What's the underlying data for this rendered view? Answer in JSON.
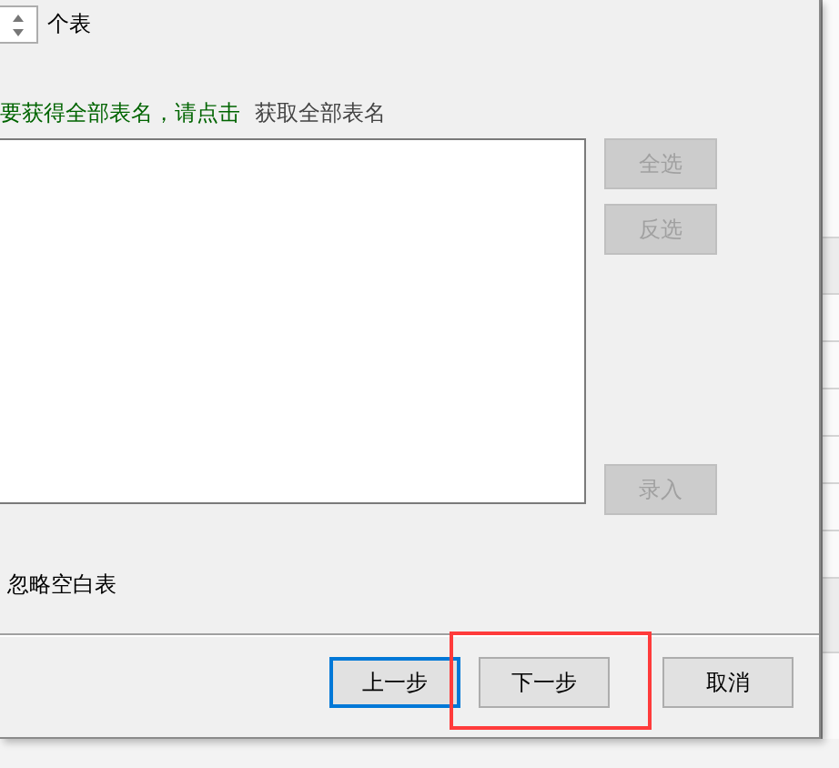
{
  "count_row": {
    "unit": "个表"
  },
  "hint": {
    "text": "要获得全部表名，请点击",
    "link": "获取全部表名"
  },
  "side_buttons": [
    {
      "label": "全选",
      "disabled": true
    },
    {
      "label": "反选",
      "disabled": true
    },
    {
      "label": "录入",
      "disabled": true
    }
  ],
  "option": {
    "label": "忽略空白表"
  },
  "footer_buttons": [
    {
      "label": "上一步",
      "focused": true,
      "highlighted": false
    },
    {
      "label": "下一步",
      "focused": false,
      "highlighted": true
    },
    {
      "label": "取消",
      "focused": false,
      "highlighted": false
    }
  ]
}
